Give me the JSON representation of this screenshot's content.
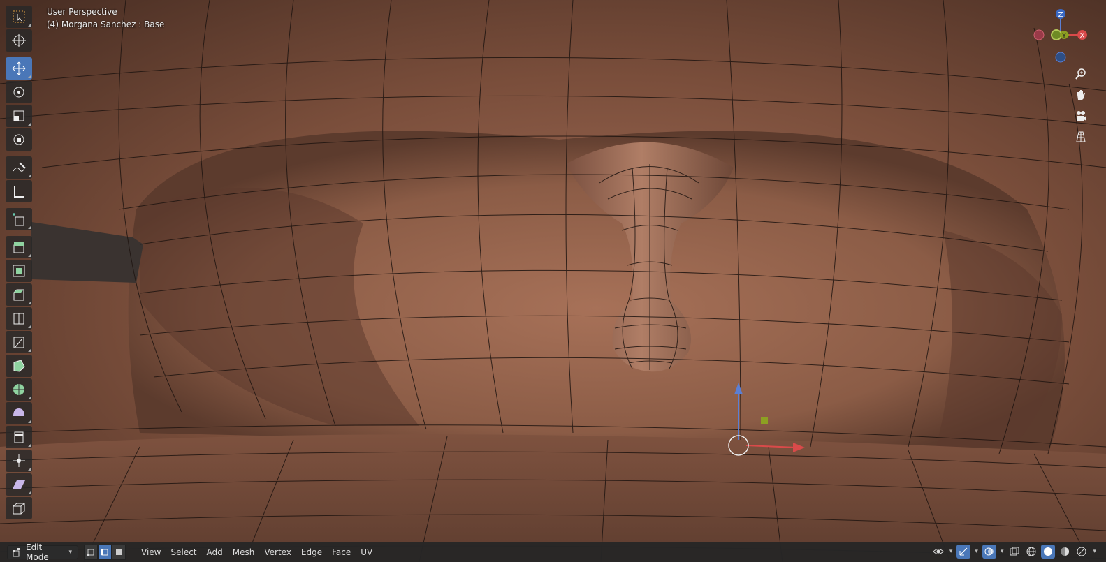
{
  "viewport": {
    "view_name": "User Perspective",
    "object_info": "(4) Morgana Sanchez : Base"
  },
  "toolbar": {
    "tools": [
      "select-box",
      "cursor",
      "move",
      "rotate",
      "scale",
      "transform",
      "annotate",
      "measure",
      "add-cube",
      "extrude-region",
      "inset-faces",
      "bevel",
      "loop-cut",
      "knife",
      "poly-build",
      "spin",
      "smooth",
      "edge-slide",
      "shrink-fatten",
      "shear",
      "to-sphere"
    ],
    "active_tool": "move"
  },
  "gizmo": {
    "z_label": "Z",
    "y_label": "Y",
    "x_label": "X"
  },
  "header": {
    "mode": "Edit Mode",
    "menus": [
      "View",
      "Select",
      "Add",
      "Mesh",
      "Vertex",
      "Edge",
      "Face",
      "UV"
    ],
    "select_mode_active": "edge"
  },
  "colors": {
    "accent": "#4a77b8",
    "mesh_base": "#8a5a42",
    "wire": "#1e1410"
  }
}
